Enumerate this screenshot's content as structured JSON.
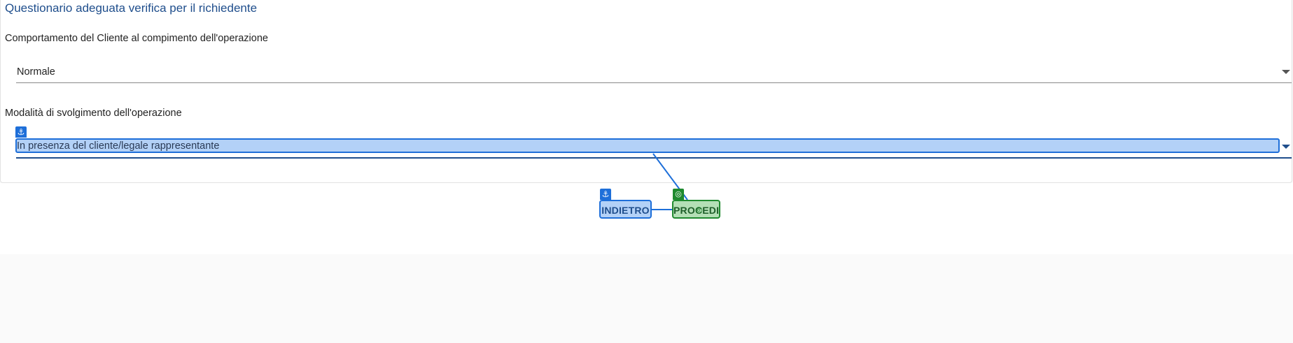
{
  "form": {
    "title": "Questionario adeguata verifica per il richiedente",
    "questions": [
      {
        "label": "Comportamento del Cliente al compimento dell'operazione",
        "value": "Normale"
      },
      {
        "label": "Modalità di svolgimento dell'operazione",
        "value": "In presenza del cliente/legale rappresentante"
      }
    ]
  },
  "actions": {
    "back_label": "INDIETRO",
    "next_label": "PROCEDI"
  },
  "annotations": {
    "anchor_icon": "anchor-icon",
    "target_icon": "target-icon",
    "anchor_color": "#1e6fd9",
    "target_color": "#1f8a2f"
  }
}
